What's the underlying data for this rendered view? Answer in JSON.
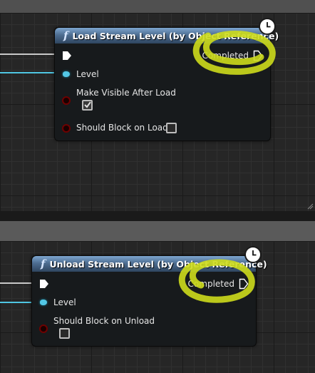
{
  "colors": {
    "header": "#4e6e92",
    "exec_wire": "#c8c8c8",
    "object_pin": "#4fc6e2",
    "bool_pin": "#6e0000",
    "annotation": "#cddc1c"
  },
  "icons": {
    "function": "function-icon",
    "latent": "clock-icon",
    "exec": "exec-pin-icon"
  },
  "load_node": {
    "title": "Load Stream Level (by Object Reference)",
    "completed_label": "Completed",
    "level_label": "Level",
    "make_visible_label": "Make Visible After Load",
    "make_visible_checked": true,
    "should_block_label": "Should Block on Load",
    "should_block_checked": false
  },
  "unload_node": {
    "title": "Unload Stream Level (by Object Reference)",
    "completed_label": "Completed",
    "level_label": "Level",
    "should_block_label": "Should Block on Unload",
    "should_block_checked": false
  }
}
